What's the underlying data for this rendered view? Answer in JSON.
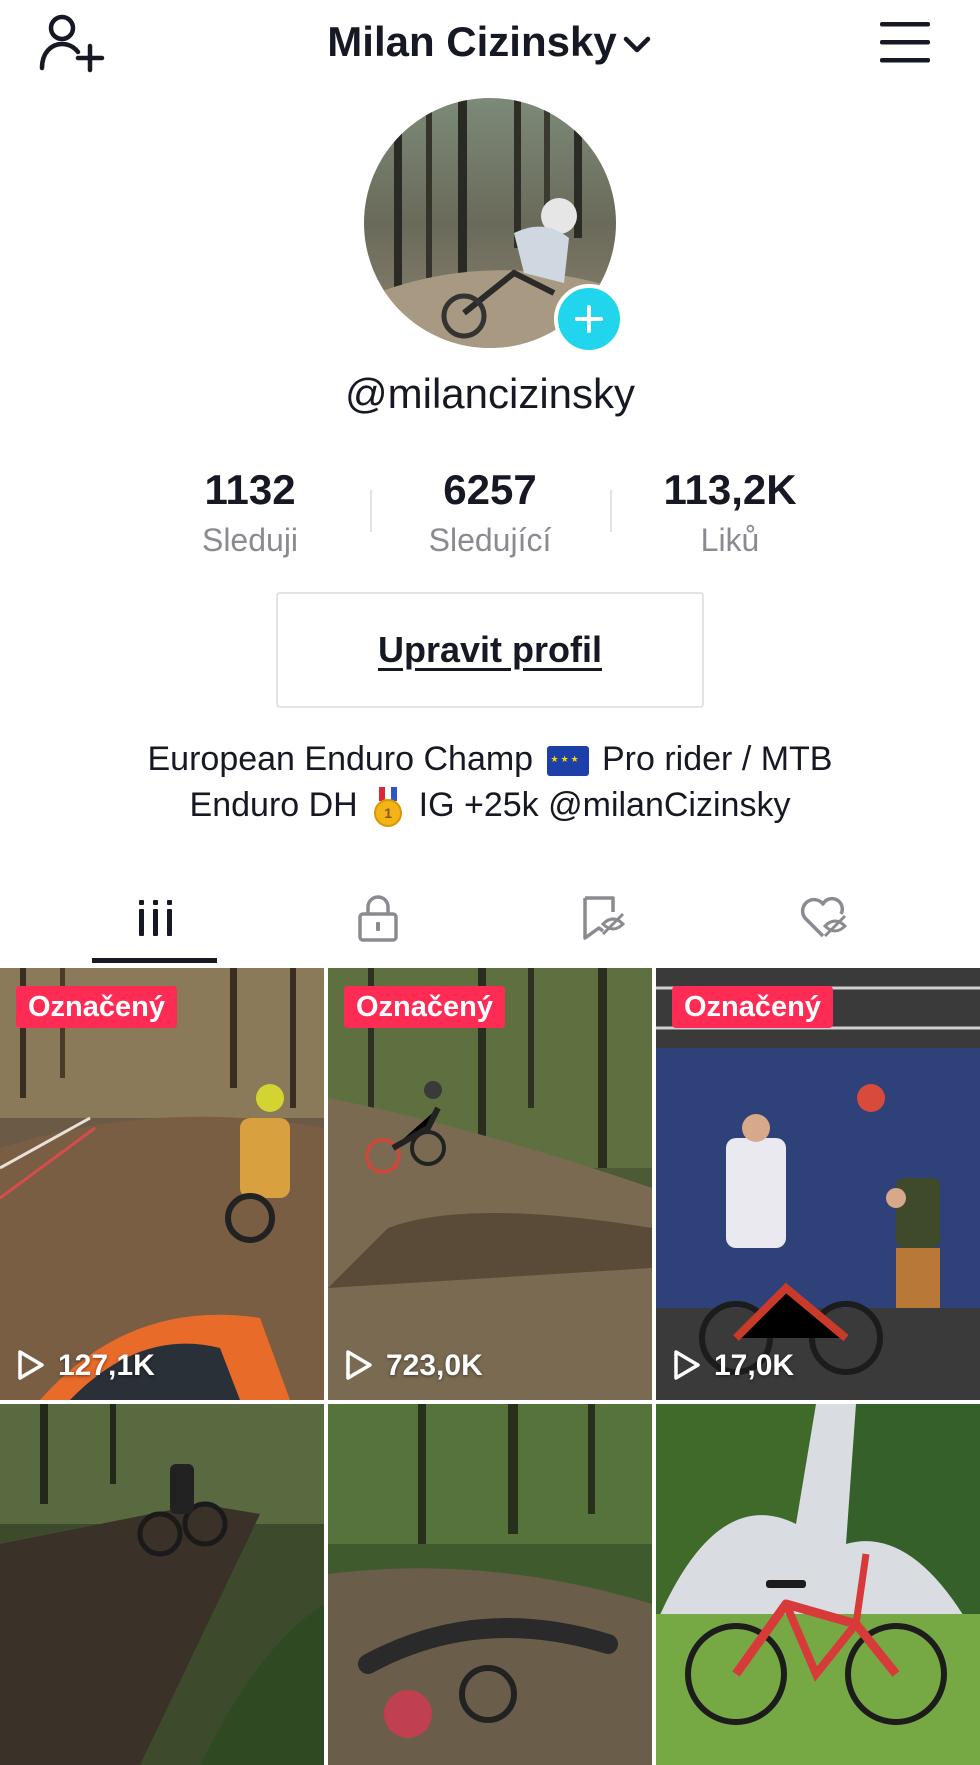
{
  "header": {
    "username_title": "Milan Cizinsky",
    "add_user_icon": "add-user-icon",
    "menu_icon": "hamburger-menu-icon",
    "dropdown_icon": "chevron-down-icon"
  },
  "profile": {
    "handle": "@milancizinsky",
    "avatar_add_icon": "plus-icon"
  },
  "stats": [
    {
      "value": "1132",
      "label": "Sleduji"
    },
    {
      "value": "6257",
      "label": "Sledující"
    },
    {
      "value": "113,2K",
      "label": "Liků"
    }
  ],
  "edit_profile_label": "Upravit profil",
  "bio": {
    "line1_a": "European Enduro Champ",
    "line1_b": "Pro rider / MTB",
    "line2_a": "Enduro DH",
    "line2_b": "IG +25k @milanCizinsky",
    "medal_digit": "1"
  },
  "tabs": [
    {
      "name": "videos",
      "icon": "grid-icon",
      "active": true
    },
    {
      "name": "private",
      "icon": "lock-icon",
      "active": false
    },
    {
      "name": "saved-hidden",
      "icon": "bookmark-hidden-icon",
      "active": false
    },
    {
      "name": "liked-hidden",
      "icon": "heart-hidden-icon",
      "active": false
    }
  ],
  "videos": [
    {
      "badge": "Označený",
      "views": "127,1K"
    },
    {
      "badge": "Označený",
      "views": "723,0K"
    },
    {
      "badge": "Označený",
      "views": "17,0K"
    },
    {
      "badge": "",
      "views": ""
    },
    {
      "badge": "",
      "views": ""
    },
    {
      "badge": "",
      "views": ""
    }
  ],
  "colors": {
    "accent_red": "#fe2c55",
    "avatar_plus": "#20d5ec",
    "text_primary": "#161823",
    "text_secondary": "#8a8b91"
  }
}
